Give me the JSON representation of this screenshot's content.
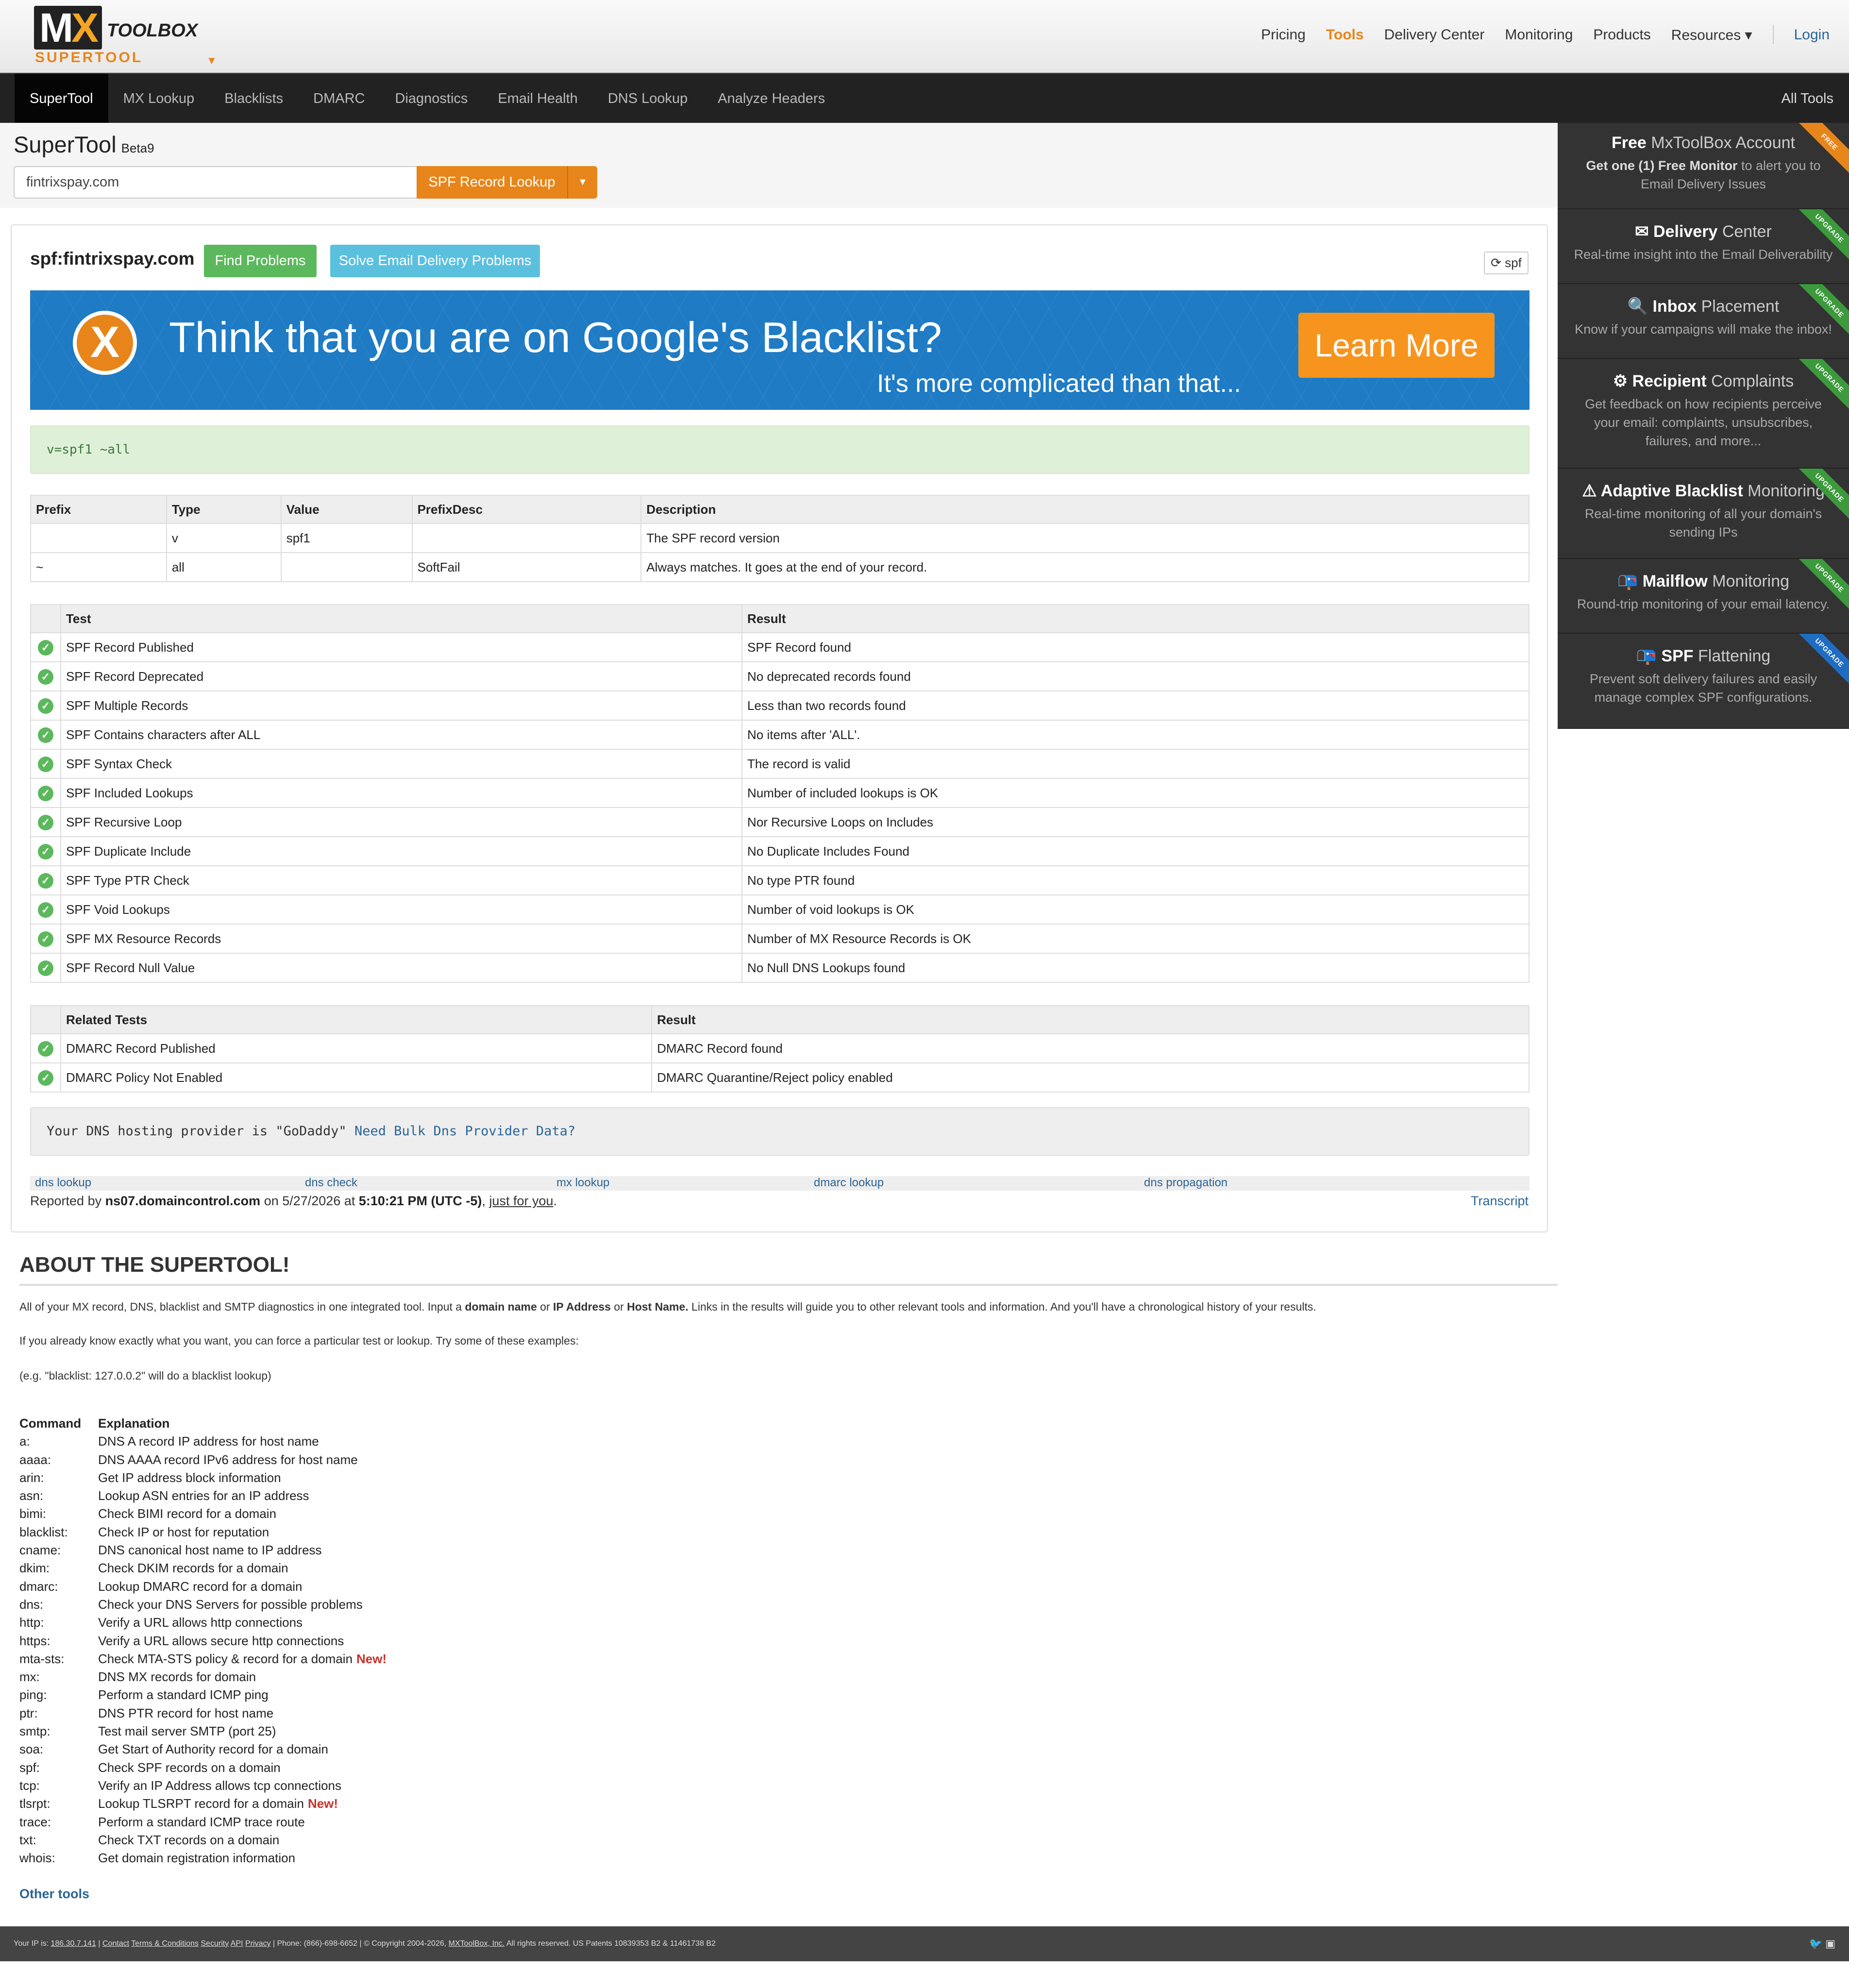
{
  "topbar": {
    "logo_mx": "MX",
    "logo_toolbox": "TOOLBOX",
    "logo_sub": "SUPERTOOL",
    "nav": [
      {
        "label": "Pricing",
        "active": false
      },
      {
        "label": "Tools",
        "active": true
      },
      {
        "label": "Delivery Center",
        "active": false
      },
      {
        "label": "Monitoring",
        "active": false
      },
      {
        "label": "Products",
        "active": false
      },
      {
        "label": "Resources ▾",
        "active": false
      }
    ],
    "login": "Login"
  },
  "navbar": {
    "items": [
      "SuperTool",
      "MX Lookup",
      "Blacklists",
      "DMARC",
      "Diagnostics",
      "Email Health",
      "DNS Lookup",
      "Analyze Headers"
    ],
    "active_index": 0,
    "all_tools": "All Tools"
  },
  "search": {
    "title": "SuperTool",
    "beta": "Beta9",
    "value": "fintrixspay.com",
    "button": "SPF Record Lookup"
  },
  "result": {
    "title": "spf:fintrixspay.com",
    "find_problems": "Find Problems",
    "solve_problems": "Solve Email Delivery Problems",
    "refresh_label": "spf",
    "banner": {
      "headline": "Think that you are on Google's Blacklist?",
      "sub": "It's more complicated than that...",
      "button": "Learn More"
    },
    "record": "v=spf1 ~all",
    "prefix_table": {
      "headers": [
        "Prefix",
        "Type",
        "Value",
        "PrefixDesc",
        "Description"
      ],
      "rows": [
        [
          "",
          "v",
          "spf1",
          "",
          "The SPF record version"
        ],
        [
          "~",
          "all",
          "",
          "SoftFail",
          "Always matches. It goes at the end of your record."
        ]
      ]
    },
    "tests": {
      "headers": [
        "Test",
        "Result"
      ],
      "rows": [
        [
          "SPF Record Published",
          "SPF Record found"
        ],
        [
          "SPF Record Deprecated",
          "No deprecated records found"
        ],
        [
          "SPF Multiple Records",
          "Less than two records found"
        ],
        [
          "SPF Contains characters after ALL",
          "No items after 'ALL'."
        ],
        [
          "SPF Syntax Check",
          "The record is valid"
        ],
        [
          "SPF Included Lookups",
          "Number of included lookups is OK"
        ],
        [
          "SPF Recursive Loop",
          "Nor Recursive Loops on Includes"
        ],
        [
          "SPF Duplicate Include",
          "No Duplicate Includes Found"
        ],
        [
          "SPF Type PTR Check",
          "No type PTR found"
        ],
        [
          "SPF Void Lookups",
          "Number of void lookups is OK"
        ],
        [
          "SPF MX Resource Records",
          "Number of MX Resource Records is OK"
        ],
        [
          "SPF Record Null Value",
          "No Null DNS Lookups found"
        ]
      ]
    },
    "related": {
      "headers": [
        "Related Tests",
        "Result"
      ],
      "rows": [
        [
          "DMARC Record Published",
          "DMARC Record found"
        ],
        [
          "DMARC Policy Not Enabled",
          "DMARC Quarantine/Reject policy enabled"
        ]
      ]
    },
    "dns_provider": "Your DNS hosting provider is \"GoDaddy\"",
    "dns_provider_link": "Need Bulk Dns Provider Data?",
    "links": [
      "dns lookup",
      "dns check",
      "mx lookup",
      "dmarc lookup",
      "dns propagation"
    ],
    "reported_prefix": "Reported by",
    "reported_server": "ns07.domaincontrol.com",
    "reported_on": "on 5/27/2026 at",
    "reported_time": "5:10:21 PM (UTC -5)",
    "reported_for": "just for you",
    "transcript": "Transcript"
  },
  "sidebar": [
    {
      "bold": "Free",
      "light": "MxToolBox Account",
      "desc_bold": "Get one (1) Free Monitor",
      "desc": "to alert you to Email Delivery Issues",
      "ribbon": "FREE",
      "icon": ""
    },
    {
      "bold": "Delivery",
      "light": "Center",
      "desc_bold": "",
      "desc": "Real-time insight into the Email Deliverability",
      "ribbon": "UPGRADE",
      "icon": "mail-icon"
    },
    {
      "bold": "Inbox",
      "light": "Placement",
      "desc_bold": "",
      "desc": "Know if your campaigns will make the inbox!",
      "ribbon": "UPGRADE",
      "icon": "search-icon"
    },
    {
      "bold": "Recipient",
      "light": "Complaints",
      "desc_bold": "",
      "desc": "Get feedback on how recipients perceive your email: complaints, unsubscribes, failures, and more...",
      "ribbon": "UPGRADE",
      "icon": "gears-icon"
    },
    {
      "bold": "Adaptive Blacklist",
      "light": "Monitoring",
      "desc_bold": "",
      "desc": "Real-time monitoring of all your domain's sending IPs",
      "ribbon": "UPGRADE",
      "icon": "warning-icon"
    },
    {
      "bold": "Mailflow",
      "light": "Monitoring",
      "desc_bold": "",
      "desc": "Round-trip monitoring of your email latency.",
      "ribbon": "UPGRADE",
      "icon": "mailbox-icon"
    },
    {
      "bold": "SPF",
      "light": "Flattening",
      "desc_bold": "",
      "desc": "Prevent soft delivery failures and easily manage complex SPF configurations.",
      "ribbon": "UPGRADE",
      "icon": "mailbox-icon"
    }
  ],
  "about": {
    "title": "ABOUT THE SUPERTOOL!",
    "p1_a": "All of your MX record, DNS, blacklist and SMTP diagnostics in one integrated tool.  Input a",
    "p1_b1": "domain name",
    "p1_c": "or",
    "p1_b2": "IP Address",
    "p1_d": "or",
    "p1_b3": "Host Name.",
    "p1_e": "Links in the results will guide you to other relevant tools and information.  And you'll have a chronological history of your results.",
    "p2": "If you already know exactly what you want, you can force a particular test or lookup.  Try some of these examples:",
    "p3": "(e.g. \"blacklist: 127.0.0.2\" will do a blacklist lookup)",
    "cmd_header": [
      "Command",
      "Explanation"
    ],
    "commands": [
      [
        "a:",
        "DNS A record IP address for host name",
        ""
      ],
      [
        "aaaa:",
        "DNS AAAA record IPv6 address for host name",
        ""
      ],
      [
        "arin:",
        "Get IP address block information",
        ""
      ],
      [
        "asn:",
        "Lookup ASN entries for an IP address",
        ""
      ],
      [
        "bimi:",
        "Check BIMI record for a domain",
        ""
      ],
      [
        "blacklist:",
        "Check IP or host for reputation",
        ""
      ],
      [
        "cname:",
        "DNS canonical host name to IP address",
        ""
      ],
      [
        "dkim:",
        "Check DKIM records for a domain",
        ""
      ],
      [
        "dmarc:",
        "Lookup DMARC record for a domain",
        ""
      ],
      [
        "dns:",
        "Check your DNS Servers for possible problems",
        ""
      ],
      [
        "http:",
        "Verify a URL allows http connections",
        ""
      ],
      [
        "https:",
        "Verify a URL allows secure http connections",
        ""
      ],
      [
        "mta-sts:",
        "Check MTA-STS policy & record for a domain",
        "New!"
      ],
      [
        "mx:",
        "DNS MX records for domain",
        ""
      ],
      [
        "ping:",
        "Perform a standard ICMP ping",
        ""
      ],
      [
        "ptr:",
        "DNS PTR record for host name",
        ""
      ],
      [
        "smtp:",
        "Test mail server SMTP (port 25)",
        ""
      ],
      [
        "soa:",
        "Get Start of Authority record for a domain",
        ""
      ],
      [
        "spf:",
        "Check SPF records on a domain",
        ""
      ],
      [
        "tcp:",
        "Verify an IP Address allows tcp connections",
        ""
      ],
      [
        "tlsrpt:",
        "Lookup TLSRPT record for a domain",
        "New!"
      ],
      [
        "trace:",
        "Perform a standard ICMP trace route",
        ""
      ],
      [
        "txt:",
        "Check TXT records on a domain",
        ""
      ],
      [
        "whois:",
        "Get domain registration information",
        ""
      ]
    ],
    "other_tools": "Other tools"
  },
  "footer": {
    "ip_label": "Your IP is:",
    "ip": "186.30.7.141",
    "links": [
      "Contact",
      "Terms & Conditions",
      "Security",
      "API",
      "Privacy"
    ],
    "phone": "Phone: (866)-698-6652",
    "copyright": "© Copyright 2004-2026,",
    "company": "MXToolBox, Inc.",
    "rights": "All rights reserved. US Patents 10839353 B2 & 11461738 B2"
  }
}
